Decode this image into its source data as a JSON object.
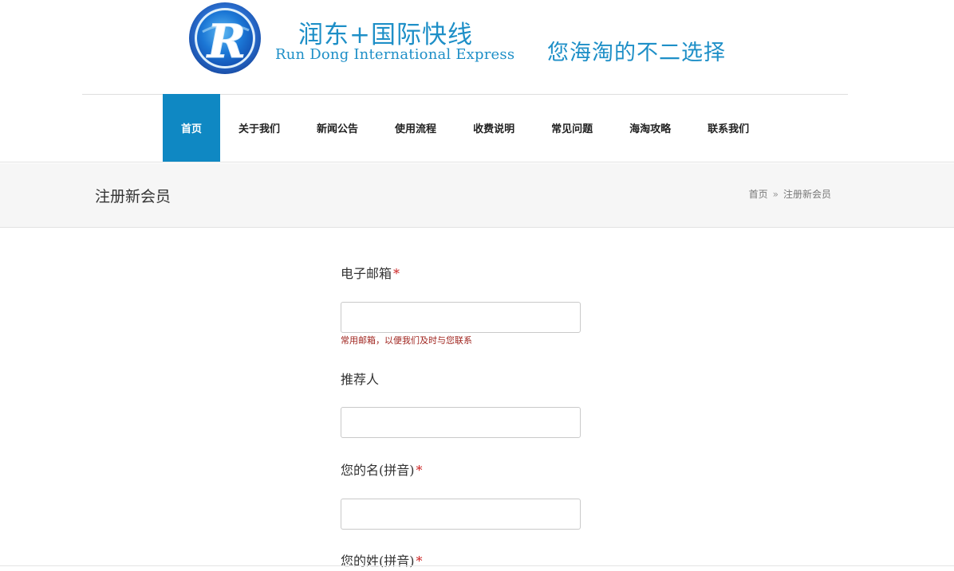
{
  "header": {
    "logo_letter": "R",
    "brand_cn": "润东+国际快线",
    "brand_en": "Run Dong International Express",
    "slogan": "您海淘的不二选择"
  },
  "nav": {
    "items": [
      {
        "label": "首页",
        "active": true
      },
      {
        "label": "关于我们"
      },
      {
        "label": "新闻公告"
      },
      {
        "label": "使用流程"
      },
      {
        "label": "收费说明"
      },
      {
        "label": "常见问题"
      },
      {
        "label": "海淘攻略"
      },
      {
        "label": "联系我们"
      }
    ]
  },
  "title_band": {
    "title": "注册新会员",
    "breadcrumb": {
      "home": "首页",
      "separator": "»",
      "current": "注册新会员"
    }
  },
  "form": {
    "email": {
      "label": "电子邮箱",
      "required_mark": "*",
      "value": "",
      "hint": "常用邮箱，以便我们及时与您联系"
    },
    "referrer": {
      "label": "推荐人",
      "value": ""
    },
    "first_name": {
      "label": "您的名(拼音)",
      "required_mark": "*",
      "value": ""
    },
    "last_name": {
      "label": "您的姓(拼音)",
      "required_mark": "*"
    }
  },
  "colors": {
    "brand_blue": "#1e8fc7",
    "nav_active": "#0f88c3",
    "hint_red": "#a0251f",
    "required_red": "#cc2222"
  }
}
